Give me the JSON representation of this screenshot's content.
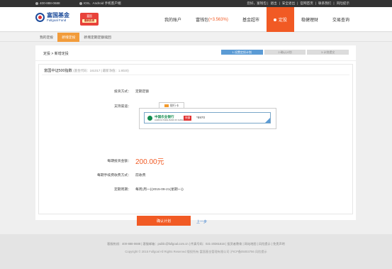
{
  "topbar": {
    "phone": "400-888-0688",
    "mobile": "IOS、Android 手机客户端",
    "links": [
      "您好，富钱包 |",
      "退出",
      "|",
      "安全退出",
      "|",
      "官网首页",
      "|",
      "联系我们",
      "|",
      "风险提示"
    ]
  },
  "header": {
    "logo_cn": "富国基金",
    "logo_en": "Fullgoal Fund",
    "promo_top": "富国",
    "promo_bottom": "最新投资",
    "nav": [
      {
        "label": "我的账户"
      },
      {
        "label": "富钱包",
        "highlight": "(+3.563%)"
      },
      {
        "label": "基金超市"
      },
      {
        "label": "定投",
        "active": true
      },
      {
        "label": "稳健理财"
      },
      {
        "label": "交易查询"
      }
    ]
  },
  "subnav": {
    "items": [
      {
        "label": "我的定投"
      },
      {
        "label": "新增定投",
        "active": true
      },
      {
        "label": "新增定期定额赎回"
      }
    ]
  },
  "main": {
    "breadcrumb": "定投 > 新增定投",
    "steps": [
      "1.设置定投计划",
      "2.确认计划",
      "3.计划提交"
    ],
    "fund_title": "富国中证500指数",
    "fund_meta": "(基金代码：161017 | 最新净值：1.8020)",
    "form": {
      "invest_method_label": "投资方式：",
      "invest_method_value": "定期定额",
      "channel_label": "支持渠道：",
      "channel_tab": "银行卡",
      "bank_name": "中国农业银行",
      "bank_sub": "AGRICULTURAL BANK OF CHINA",
      "bank_quick": "快捷",
      "card_no": "*5970",
      "amount_label": "每期投资金额：",
      "amount_value": "200.00元",
      "fee_label": "每期手续费收费方式：",
      "fee_value": "前收费",
      "period_label": "定期周期：",
      "period_value": "每周(周一)(2015-09-21(星期一))"
    },
    "confirm_button": "确认计划",
    "prev_link": "上一步"
  },
  "footer": {
    "line1": "客服热线：400-888-0688  |  客服邮箱：public@fullgoal.com.cn  |  传真号码：021-20361616  |  投资者教育  |  网站地图  |  风险提示  |  免责声明",
    "line2": "Copyright © 2015 Fullgoal All Rights Reserved 版权所有 富国基金管理有限公司 沪ICP备05003756 风险提示"
  },
  "colors": {
    "accent": "#f15a24",
    "brand": "#1e4d9b",
    "step_active": "#5b9bd5",
    "subnav_active": "#f29c3b"
  }
}
